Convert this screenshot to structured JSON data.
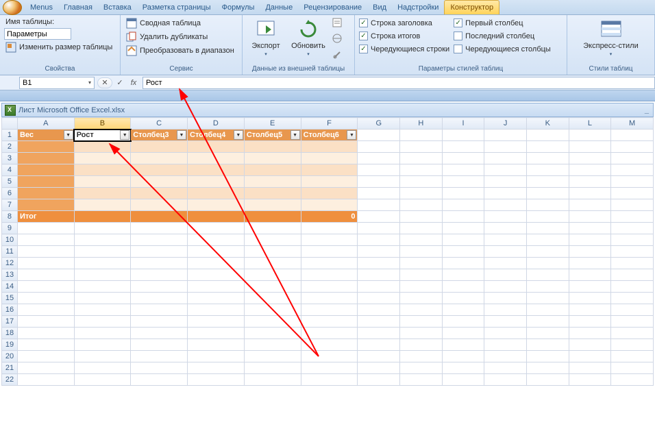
{
  "menu": {
    "items": [
      "Menus",
      "Главная",
      "Вставка",
      "Разметка страницы",
      "Формулы",
      "Данные",
      "Рецензирование",
      "Вид",
      "Надстройки",
      "Конструктор"
    ],
    "active_index": 9
  },
  "ribbon": {
    "props": {
      "label1": "Имя таблицы:",
      "table_name": "Параметры",
      "resize": "Изменить размер таблицы",
      "title": "Свойства"
    },
    "tools": {
      "pivot": "Сводная таблица",
      "dedup": "Удалить дубликаты",
      "convert": "Преобразовать в диапазон",
      "title": "Сервис"
    },
    "ext": {
      "export": "Экспорт",
      "refresh": "Обновить",
      "title": "Данные из внешней таблицы"
    },
    "styleopts": {
      "headerRow": "Строка заголовка",
      "totalRow": "Строка итогов",
      "banded": "Чередующиеся строки",
      "firstCol": "Первый столбец",
      "lastCol": "Последний столбец",
      "bandedCols": "Чередующиеся столбцы",
      "title": "Параметры стилей таблиц"
    },
    "styles": {
      "quick": "Экспресс-стили",
      "title": "Стили таблиц"
    }
  },
  "formula": {
    "cellRef": "B1",
    "value": "Рост"
  },
  "workbook": {
    "title": "Лист Microsoft Office Excel.xlsx"
  },
  "columns": [
    "A",
    "B",
    "C",
    "D",
    "E",
    "F",
    "G",
    "H",
    "I",
    "J",
    "K",
    "L",
    "M"
  ],
  "rows": [
    "1",
    "2",
    "3",
    "4",
    "5",
    "6",
    "7",
    "8",
    "9",
    "10",
    "11",
    "12",
    "13",
    "14",
    "15",
    "16",
    "17",
    "18",
    "19",
    "20",
    "21",
    "22"
  ],
  "headers": [
    "Вес",
    "Рост",
    "Столбец3",
    "Столбец4",
    "Столбец5",
    "Столбец6"
  ],
  "totalRow": {
    "label": "Итог",
    "value": "0"
  },
  "selected": {
    "colIndex": 1,
    "cell": "B1"
  },
  "icons": {
    "check": "✓",
    "cancel": "✕",
    "fx": "fx",
    "dropdown": "▾",
    "filter": "▼",
    "triangle": "▾",
    "minimize": "_"
  }
}
